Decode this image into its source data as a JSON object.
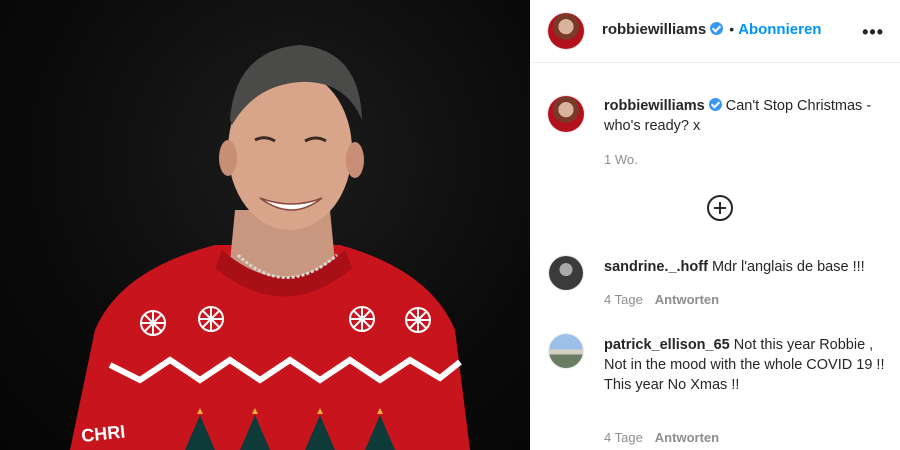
{
  "post": {
    "author": "robbiewilliams",
    "follow_label": "Abonnieren",
    "more_icon": "more-options-icon",
    "caption": "Can't Stop Christmas - who's ready? x",
    "time": "1 Wo.",
    "load_more_icon": "plus-circle-icon"
  },
  "comments": [
    {
      "user": "sandrine._.hoff",
      "text": "Mdr l'anglais de base !!!",
      "time": "4 Tage",
      "reply_label": "Antworten"
    },
    {
      "user": "patrick_ellison_65",
      "text": "Not this year Robbie , Not in the mood with the whole COVID 19 !! This year No Xmas !!",
      "time": "4 Tage",
      "reply_label": "Antworten"
    }
  ],
  "sweater_text": "CHRI"
}
